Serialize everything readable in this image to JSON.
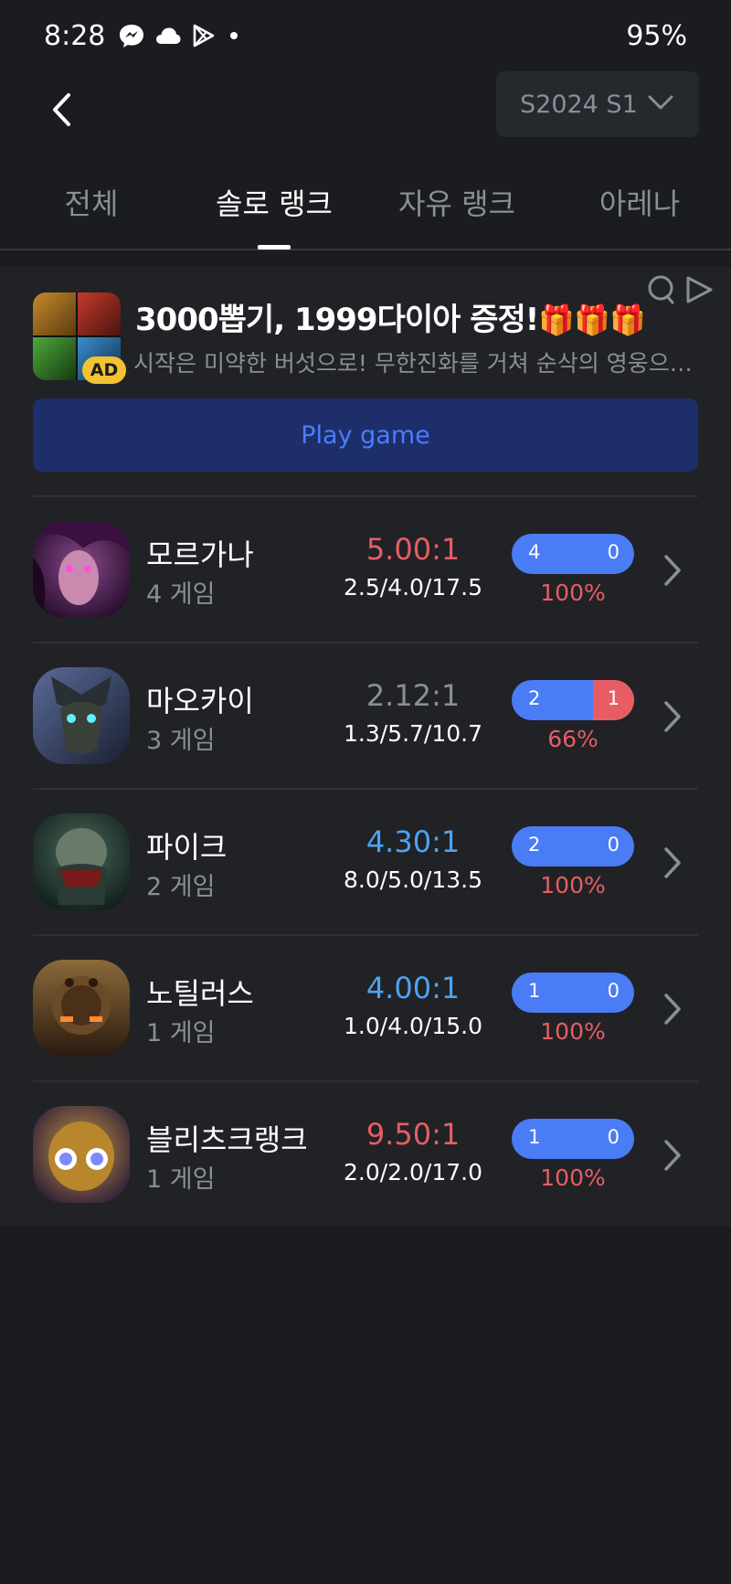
{
  "status_bar": {
    "time": "8:28",
    "battery": "95%"
  },
  "header": {
    "season": "S2024 S1"
  },
  "tabs": [
    {
      "label": "전체",
      "active": false
    },
    {
      "label": "솔로 랭크",
      "active": true
    },
    {
      "label": "자유 랭크",
      "active": false
    },
    {
      "label": "아레나",
      "active": false
    }
  ],
  "ad": {
    "badge": "AD",
    "title": "3000뽑기, 1999다이아 증정!",
    "title_gifts": "🎁🎁🎁",
    "description": "시작은 미약한 버섯으로! 무한진화를 거쳐 순삭의 영웅으로 거듭나라",
    "button_label": "Play game"
  },
  "colors": {
    "background": "#1a1c20",
    "panel": "#202226",
    "win_blue": "#4a7cf5",
    "loss_red": "#e85d63",
    "kda_red": "#e85d63",
    "kda_blue": "#4da3f0",
    "kda_gray": "#8a8e96"
  },
  "champions": [
    {
      "name": "모르가나",
      "games": "4 게임",
      "kda_ratio": "5.00:1",
      "kda_color": "#e85d63",
      "kda": "2.5/4.0/17.5",
      "wins": "4",
      "losses": "0",
      "loss_fraction": 0,
      "winrate": "100%",
      "avatar": "morgana-portrait"
    },
    {
      "name": "마오카이",
      "games": "3 게임",
      "kda_ratio": "2.12:1",
      "kda_color": "#8a8e96",
      "kda": "1.3/5.7/10.7",
      "wins": "2",
      "losses": "1",
      "loss_fraction": 0.3333,
      "winrate": "66%",
      "avatar": "maokai-portrait"
    },
    {
      "name": "파이크",
      "games": "2 게임",
      "kda_ratio": "4.30:1",
      "kda_color": "#4da3f0",
      "kda": "8.0/5.0/13.5",
      "wins": "2",
      "losses": "0",
      "loss_fraction": 0,
      "winrate": "100%",
      "avatar": "pyke-portrait"
    },
    {
      "name": "노틸러스",
      "games": "1 게임",
      "kda_ratio": "4.00:1",
      "kda_color": "#4da3f0",
      "kda": "1.0/4.0/15.0",
      "wins": "1",
      "losses": "0",
      "loss_fraction": 0,
      "winrate": "100%",
      "avatar": "nautilus-portrait"
    },
    {
      "name": "블리츠크랭크",
      "games": "1 게임",
      "kda_ratio": "9.50:1",
      "kda_color": "#e85d63",
      "kda": "2.0/2.0/17.0",
      "wins": "1",
      "losses": "0",
      "loss_fraction": 0,
      "winrate": "100%",
      "avatar": "blitzcrank-portrait"
    }
  ]
}
